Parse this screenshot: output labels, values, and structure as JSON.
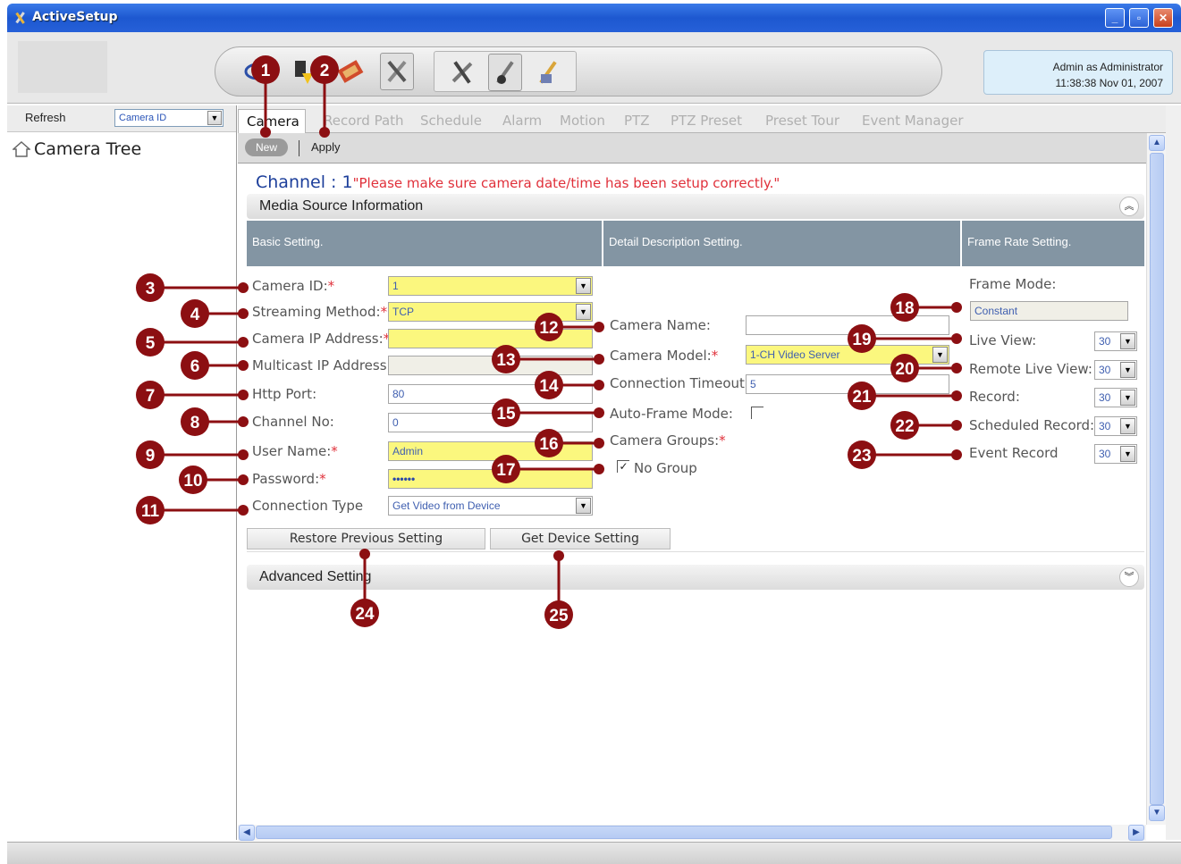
{
  "window": {
    "title": "ActiveSetup",
    "minimize": "_",
    "maximize": "▫",
    "close": "✕"
  },
  "user": {
    "login": "Admin as Administrator",
    "datetime": "11:38:38 Nov 01, 2007"
  },
  "left_panel": {
    "refresh_label": "Refresh",
    "sort_value": "Camera ID",
    "tree_title": "Camera Tree"
  },
  "tabs": [
    {
      "label": "Camera",
      "active": true
    },
    {
      "label": "Record Path"
    },
    {
      "label": "Schedule"
    },
    {
      "label": "Alarm"
    },
    {
      "label": "Motion"
    },
    {
      "label": "PTZ"
    },
    {
      "label": "PTZ Preset"
    },
    {
      "label": "Preset Tour"
    },
    {
      "label": "Event Manager"
    }
  ],
  "actions": {
    "new_label": "New",
    "apply_label": "Apply"
  },
  "channel": {
    "label": "Channel : 1",
    "warning": "\"Please make sure camera date/time has been setup correctly.\""
  },
  "sections": {
    "media_source": "Media Source Information",
    "advanced": "Advanced Setting"
  },
  "column_headers": {
    "basic": "Basic Setting.",
    "detail": "Detail Description Setting.",
    "frame_rate": "Frame Rate Setting."
  },
  "basic": {
    "camera_id": {
      "label": "Camera ID:",
      "value": "1"
    },
    "streaming_method": {
      "label": "Streaming Method:",
      "value": "TCP"
    },
    "camera_ip": {
      "label": "Camera IP Address:",
      "value": ""
    },
    "multicast_ip": {
      "label": "Multicast IP Address",
      "value": ""
    },
    "http_port": {
      "label": "Http Port:",
      "value": "80"
    },
    "channel_no": {
      "label": "Channel No:",
      "value": "0"
    },
    "user_name": {
      "label": "User Name:",
      "value": "Admin"
    },
    "password": {
      "label": "Password:",
      "value": "••••••"
    },
    "connection_type": {
      "label": "Connection Type",
      "value": "Get Video from Device"
    }
  },
  "detail": {
    "camera_name": {
      "label": "Camera Name:",
      "value": ""
    },
    "camera_model": {
      "label": "Camera Model:",
      "value": "1-CH Video Server"
    },
    "connection_timeout": {
      "label": "Connection Timeout:",
      "value": "5"
    },
    "auto_frame_mode": {
      "label": "Auto-Frame Mode:",
      "checked": false
    },
    "camera_groups": {
      "label": "Camera Groups:"
    },
    "no_group": {
      "label": "No Group",
      "checked": true
    }
  },
  "frame_rate": {
    "frame_mode": {
      "label": "Frame Mode:",
      "value": "Constant"
    },
    "live_view": {
      "label": "Live View:",
      "value": "30"
    },
    "remote_live_view": {
      "label": "Remote Live View:",
      "value": "30"
    },
    "record": {
      "label": "Record:",
      "value": "30"
    },
    "scheduled_record": {
      "label": "Scheduled Record:",
      "value": "30"
    },
    "event_record": {
      "label": "Event Record",
      "value": "30"
    }
  },
  "buttons": {
    "restore": "Restore Previous Setting",
    "get_device": "Get Device Setting"
  },
  "required_mark": "*",
  "callouts": [
    "1",
    "2",
    "3",
    "4",
    "5",
    "6",
    "7",
    "8",
    "9",
    "10",
    "11",
    "12",
    "13",
    "14",
    "15",
    "16",
    "17",
    "18",
    "19",
    "20",
    "21",
    "22",
    "23",
    "24",
    "25"
  ],
  "colors": {
    "callout": "#8c0f12",
    "titlebar": "#1d58d0",
    "required": "#e0303a",
    "field_yellow": "#fbf77e",
    "header_slate": "#8395a3"
  }
}
